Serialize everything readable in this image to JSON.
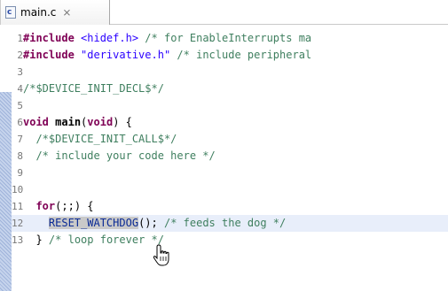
{
  "tab": {
    "icon": "c-source-file-icon",
    "icon_letter": "c",
    "title": "main.c",
    "close_glyph": "⨯"
  },
  "colors": {
    "keyword": "#7f0055",
    "string": "#2a00ff",
    "comment": "#3f7f5f",
    "macro": "#0a2a95",
    "line_number": "#787878",
    "current_line_bg": "#e8eefa",
    "selection_bg": "#c9c9c9"
  },
  "code": {
    "l1": {
      "num": "1",
      "directive": "#include",
      "header": "<hidef.h>",
      "comment": "/* for EnableInterrupts ma"
    },
    "l2": {
      "num": "2",
      "directive": "#include",
      "header": "\"derivative.h\"",
      "comment": "/* include peripheral"
    },
    "l3": {
      "num": "3"
    },
    "l4": {
      "num": "4",
      "comment": "/*$DEVICE_INIT_DECL$*/"
    },
    "l5": {
      "num": "5"
    },
    "l6": {
      "num": "6",
      "kw1": "void",
      "name": "main",
      "paren_open": "(",
      "kw2": "void",
      "paren_close": ") {"
    },
    "l7": {
      "num": "7",
      "comment": "/*$DEVICE_INIT_CALL$*/"
    },
    "l8": {
      "num": "8",
      "comment": "/* include your code here */"
    },
    "l9": {
      "num": "9"
    },
    "l10": {
      "num": "10"
    },
    "l11": {
      "num": "11",
      "kw": "for",
      "rest": "(;;) {"
    },
    "l12": {
      "num": "12",
      "macro": "RESET_WATCHDOG",
      "call": "();",
      "comment": "/* feeds the dog */"
    },
    "l13": {
      "num": "13",
      "brace": "}",
      "comment": "/* loop forever */"
    }
  },
  "cursor": "hand-pointer-cursor-icon"
}
